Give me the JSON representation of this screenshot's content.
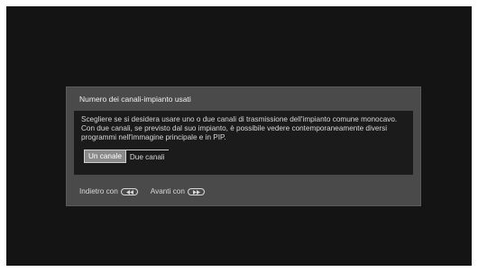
{
  "dialog": {
    "title": "Numero dei canali-impianto usati",
    "message": "Scegliere se si desidera usare uno o due canali di trasmissione dell'impianto comune monocavo. Con due canali, se previsto dal suo impianto, è possibile vedere contemporaneamente diversi programmi nell'immagine principale e in PIP.",
    "options": [
      {
        "label": "Un canale",
        "selected": true
      },
      {
        "label": "Due canali",
        "selected": false
      }
    ]
  },
  "footer": {
    "back_label": "Indietro con",
    "back_icon": "rewind-key-icon",
    "next_label": "Avanti con",
    "next_icon": "fast-forward-key-icon"
  },
  "colors": {
    "screen_background": "#141414",
    "dialog_background": "#4a4a4a",
    "body_background": "#1b1b1b",
    "selected_option": "#8a8a8a",
    "text": "#d8d8d8"
  }
}
